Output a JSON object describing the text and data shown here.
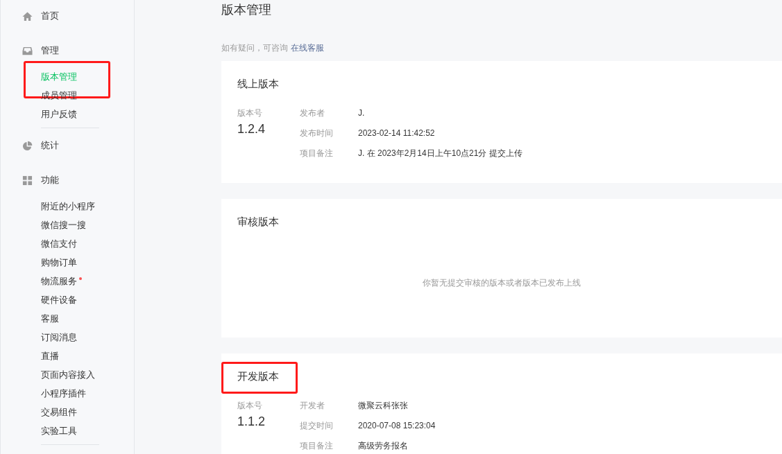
{
  "sidebar": {
    "nav": [
      {
        "label": "首页"
      },
      {
        "label": "管理",
        "children": [
          {
            "label": "版本管理",
            "selected": true,
            "highlighted": true,
            "dot": false
          },
          {
            "label": "成员管理",
            "selected": false,
            "highlighted": false,
            "dot": false
          },
          {
            "label": "用户反馈",
            "selected": false,
            "highlighted": false,
            "dot": false
          }
        ]
      },
      {
        "label": "统计"
      },
      {
        "label": "功能",
        "children": [
          {
            "label": "附近的小程序",
            "selected": false,
            "highlighted": false,
            "dot": false
          },
          {
            "label": "微信搜一搜",
            "selected": false,
            "highlighted": false,
            "dot": false
          },
          {
            "label": "微信支付",
            "selected": false,
            "highlighted": false,
            "dot": false
          },
          {
            "label": "购物订单",
            "selected": false,
            "highlighted": false,
            "dot": false
          },
          {
            "label": "物流服务",
            "selected": false,
            "highlighted": false,
            "dot": true
          },
          {
            "label": "硬件设备",
            "selected": false,
            "highlighted": false,
            "dot": false
          },
          {
            "label": "客服",
            "selected": false,
            "highlighted": false,
            "dot": false
          },
          {
            "label": "订阅消息",
            "selected": false,
            "highlighted": false,
            "dot": false
          },
          {
            "label": "直播",
            "selected": false,
            "highlighted": false,
            "dot": false
          },
          {
            "label": "页面内容接入",
            "selected": false,
            "highlighted": false,
            "dot": false
          },
          {
            "label": "小程序插件",
            "selected": false,
            "highlighted": false,
            "dot": false
          },
          {
            "label": "交易组件",
            "selected": false,
            "highlighted": false,
            "dot": false
          },
          {
            "label": "实验工具",
            "selected": false,
            "highlighted": false,
            "dot": false
          }
        ]
      }
    ]
  },
  "page": {
    "title": "版本管理",
    "hint": "如有疑问，可咨询",
    "hint_link": "在线客服"
  },
  "cards": [
    {
      "title": "线上版本",
      "highlighted": false,
      "version_label": "版本号",
      "version": "1.2.4",
      "fields": [
        {
          "label": "发布者",
          "value": "J."
        },
        {
          "label": "发布时间",
          "value": "2023-02-14 11:42:52"
        },
        {
          "label": "项目备注",
          "value": "J. 在 2023年2月14日上午10点21分 提交上传"
        }
      ]
    },
    {
      "title": "审核版本",
      "highlighted": false,
      "empty_text": "你暂无提交审核的版本或者版本已发布上线"
    },
    {
      "title": "开发版本",
      "highlighted": true,
      "version_label": "版本号",
      "version": "1.1.2",
      "fields": [
        {
          "label": "开发者",
          "value": "微聚云科张张"
        },
        {
          "label": "提交时间",
          "value": "2020-07-08 15:23:04"
        },
        {
          "label": "项目备注",
          "value": "高级劳务报名"
        }
      ]
    }
  ]
}
